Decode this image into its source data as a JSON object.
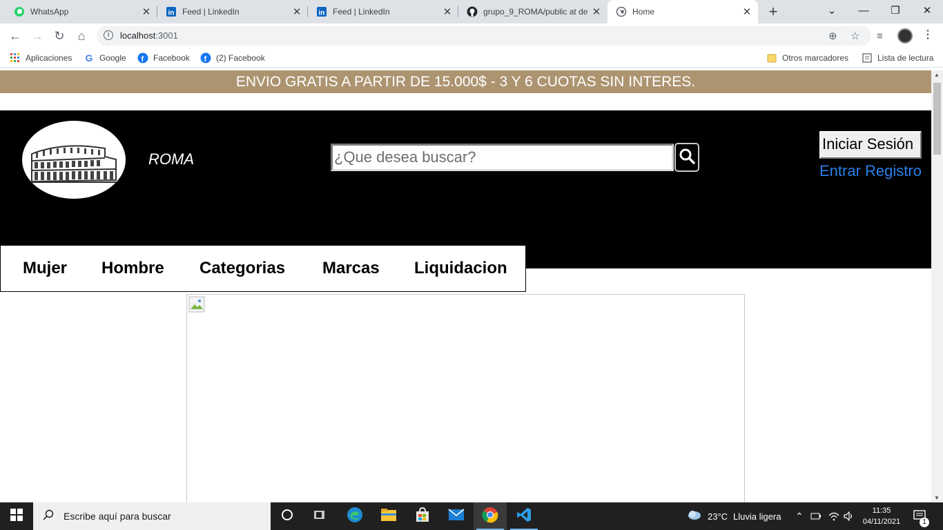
{
  "tabs": [
    {
      "title": "WhatsApp",
      "icon": "whatsapp-icon"
    },
    {
      "title": "Feed | LinkedIn",
      "icon": "linkedin-icon"
    },
    {
      "title": "Feed | LinkedIn",
      "icon": "linkedin-icon"
    },
    {
      "title": "grupo_9_ROMA/public at de",
      "icon": "github-icon"
    },
    {
      "title": "Home",
      "icon": "globe-icon"
    }
  ],
  "address": {
    "host": "localhost",
    "port": ":3001"
  },
  "bookmarks": {
    "apps": "Aplicaciones",
    "google": "Google",
    "facebook": "Facebook",
    "facebook2": "(2) Facebook",
    "other": "Otros marcadores",
    "reading": "Lista de lectura"
  },
  "page": {
    "promo": "ENVIO GRATIS A PARTIR DE 15.000$ - 3 Y 6 CUOTAS SIN INTERES.",
    "brand": "ROMA",
    "search_placeholder": "¿Que desea buscar?",
    "login_button": "Iniciar Sesión",
    "enter_link": "Entrar",
    "register_link": "Registro",
    "nav": {
      "women": "Mujer",
      "men": "Hombre",
      "categories": "Categorias",
      "brands": "Marcas",
      "sale": "Liquidacion"
    }
  },
  "taskbar": {
    "search_placeholder": "Escribe aquí para buscar",
    "weather": "23°C",
    "weather_desc": "Lluvia ligera",
    "time": "11:35",
    "date": "04/11/2021",
    "notifications": "1"
  },
  "colors": {
    "promo_bg": "#ad9471",
    "header_bg": "#000000",
    "link": "#2b7ee9"
  }
}
